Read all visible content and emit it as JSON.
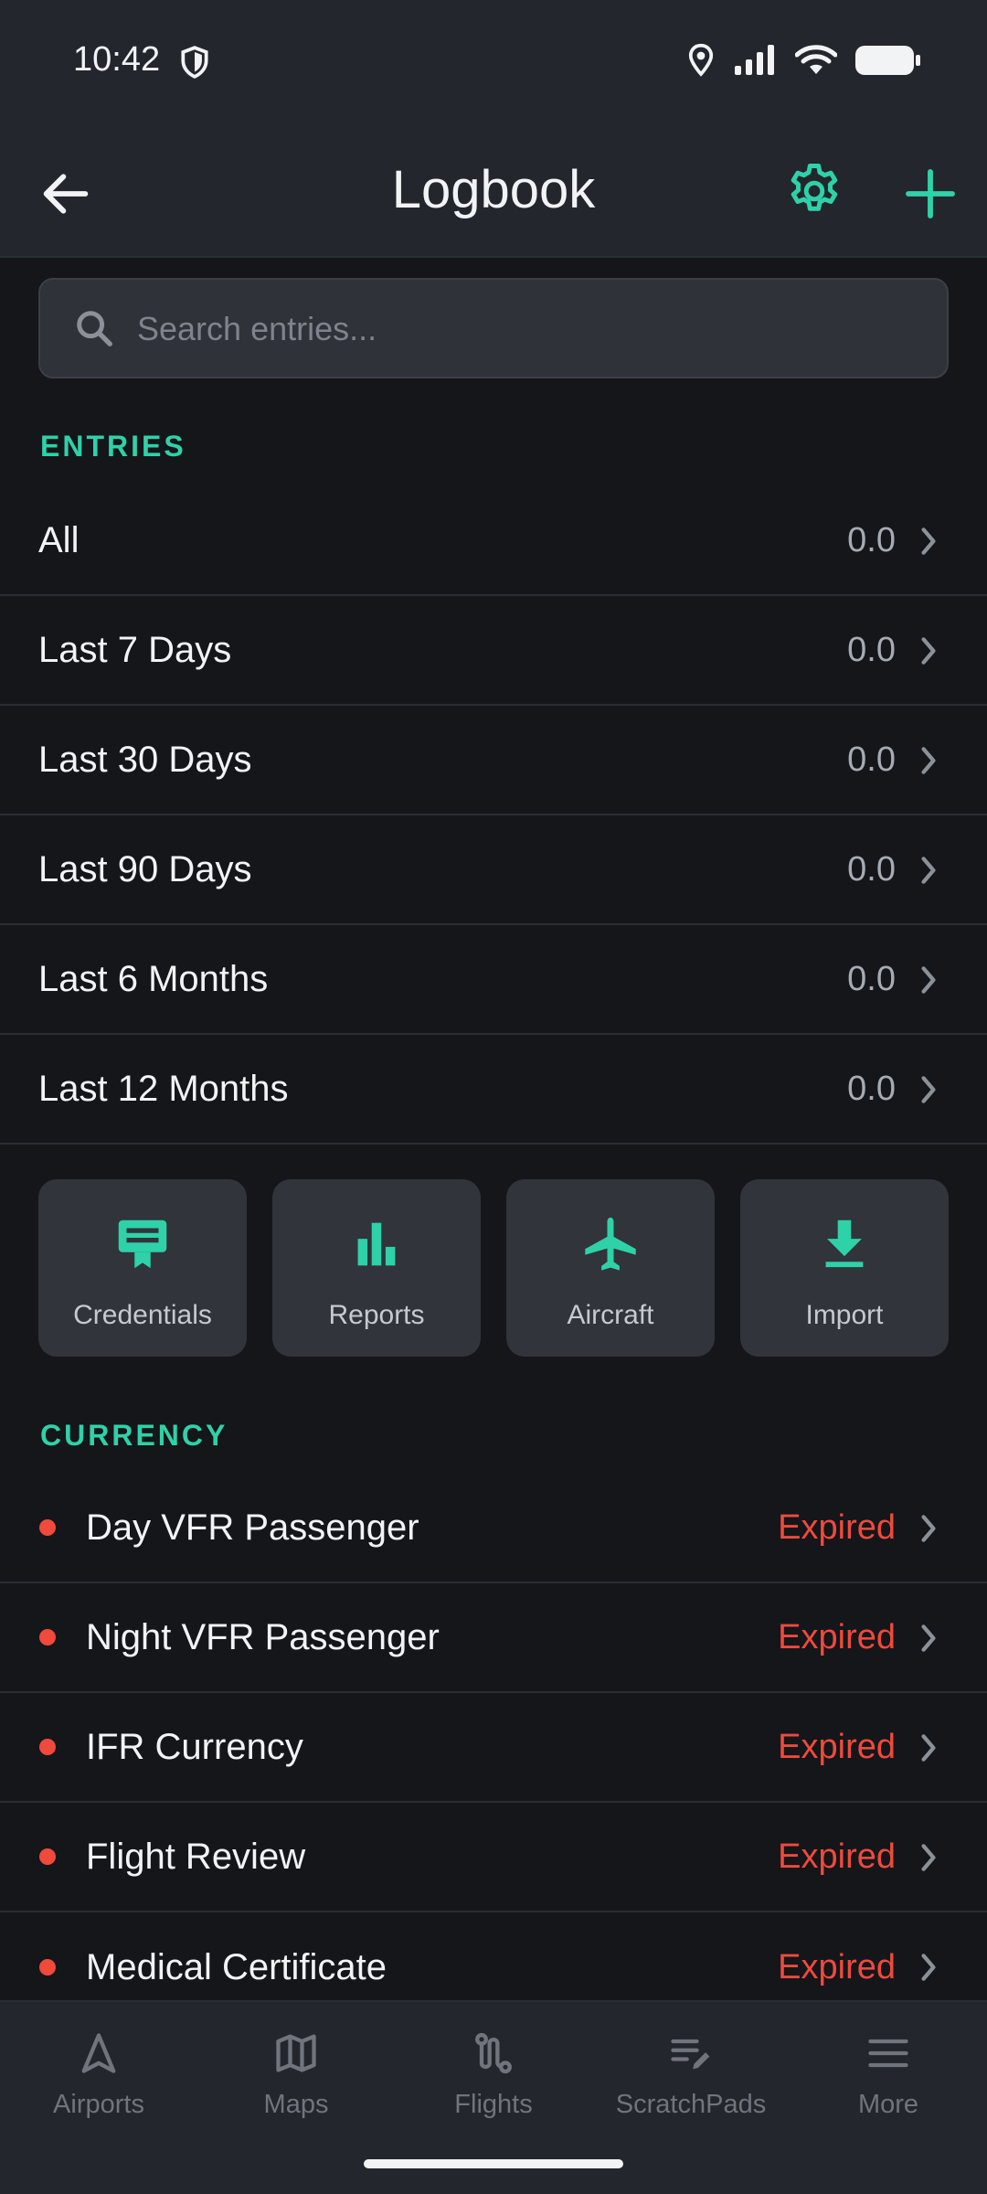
{
  "status_bar": {
    "time": "10:42"
  },
  "header": {
    "title": "Logbook"
  },
  "search": {
    "placeholder": "Search entries..."
  },
  "entries": {
    "section_label": "ENTRIES",
    "items": [
      {
        "label": "All",
        "value": "0.0"
      },
      {
        "label": "Last 7 Days",
        "value": "0.0"
      },
      {
        "label": "Last 30 Days",
        "value": "0.0"
      },
      {
        "label": "Last 90 Days",
        "value": "0.0"
      },
      {
        "label": "Last 6 Months",
        "value": "0.0"
      },
      {
        "label": "Last 12 Months",
        "value": "0.0"
      }
    ]
  },
  "tiles": [
    {
      "label": "Credentials",
      "icon": "credentials-icon"
    },
    {
      "label": "Reports",
      "icon": "bar-chart-icon"
    },
    {
      "label": "Aircraft",
      "icon": "airplane-icon"
    },
    {
      "label": "Import",
      "icon": "download-icon"
    }
  ],
  "currency": {
    "section_label": "CURRENCY",
    "items": [
      {
        "label": "Day VFR Passenger",
        "status": "Expired"
      },
      {
        "label": "Night VFR Passenger",
        "status": "Expired"
      },
      {
        "label": "IFR Currency",
        "status": "Expired"
      },
      {
        "label": "Flight Review",
        "status": "Expired"
      },
      {
        "label": "Medical Certificate",
        "status": "Expired"
      }
    ]
  },
  "tabbar": {
    "items": [
      {
        "label": "Airports",
        "icon": "navigation-arrow-icon"
      },
      {
        "label": "Maps",
        "icon": "map-icon"
      },
      {
        "label": "Flights",
        "icon": "route-icon"
      },
      {
        "label": "ScratchPads",
        "icon": "notes-edit-icon"
      },
      {
        "label": "More",
        "icon": "menu-icon"
      }
    ]
  },
  "colors": {
    "accent": "#2fd1a8",
    "expired": "#ef4a3c",
    "background": "#14161a",
    "surface": "#23262d"
  }
}
